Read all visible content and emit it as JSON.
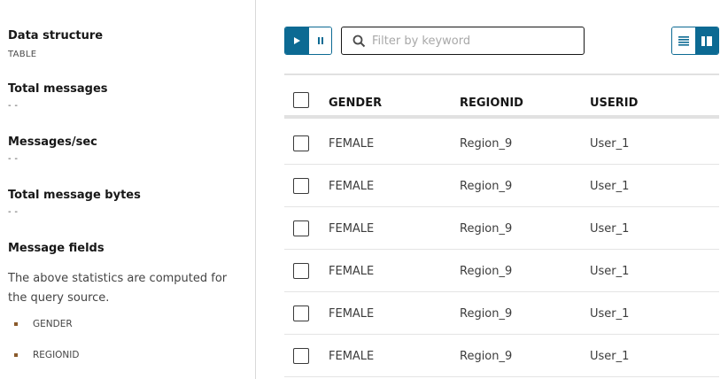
{
  "stats": {
    "data_structure": {
      "label": "Data structure",
      "value": "TABLE"
    },
    "total_messages": {
      "label": "Total messages",
      "value": "- -"
    },
    "messages_per_sec": {
      "label": "Messages/sec",
      "value": "- -"
    },
    "total_message_bytes": {
      "label": "Total message bytes",
      "value": "- -"
    },
    "message_fields": {
      "label": "Message fields",
      "description": "The above statistics are computed for the query source.",
      "fields": [
        "GENDER",
        "REGIONID"
      ]
    }
  },
  "toolbar": {
    "play_icon": "play-icon",
    "pause_icon": "pause-icon",
    "filter_placeholder": "Filter by keyword",
    "filter_value": "",
    "list_view_icon": "list-view-icon",
    "card_view_icon": "card-view-icon",
    "accent_color": "#0c6a93"
  },
  "table": {
    "columns": [
      "GENDER",
      "REGIONID",
      "USERID"
    ],
    "rows": [
      [
        "FEMALE",
        "Region_9",
        "User_1"
      ],
      [
        "FEMALE",
        "Region_9",
        "User_1"
      ],
      [
        "FEMALE",
        "Region_9",
        "User_1"
      ],
      [
        "FEMALE",
        "Region_9",
        "User_1"
      ],
      [
        "FEMALE",
        "Region_9",
        "User_1"
      ],
      [
        "FEMALE",
        "Region_9",
        "User_1"
      ]
    ]
  }
}
